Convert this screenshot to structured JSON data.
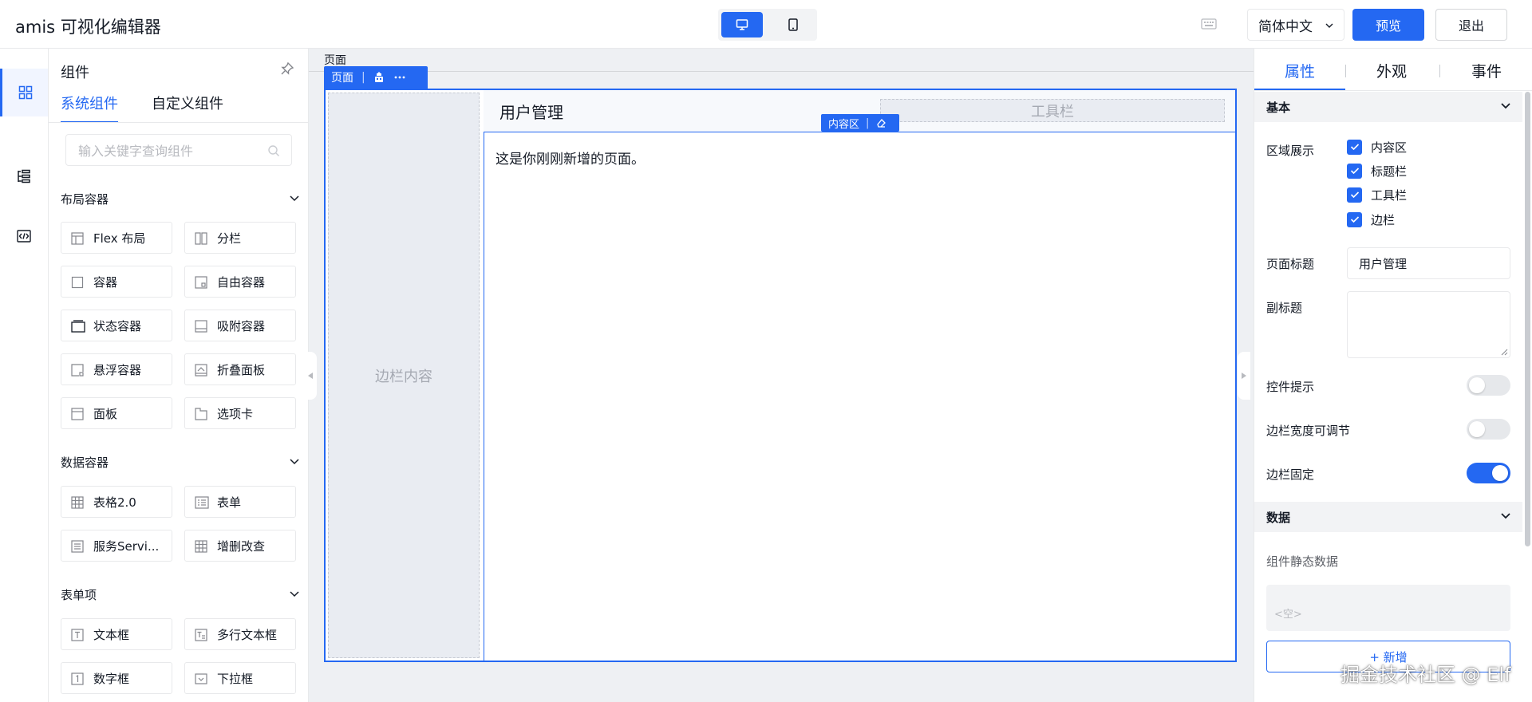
{
  "header": {
    "title": "amis 可视化编辑器",
    "language": "简体中文",
    "preview_label": "预览",
    "exit_label": "退出"
  },
  "component_panel": {
    "title": "组件",
    "tabs": [
      {
        "label": "系统组件",
        "active": true
      },
      {
        "label": "自定义组件",
        "active": false
      }
    ],
    "search_placeholder": "输入关键字查询组件",
    "groups": [
      {
        "title": "布局容器",
        "items": [
          {
            "label": "Flex 布局",
            "icon": "flex-layout-icon"
          },
          {
            "label": "分栏",
            "icon": "columns-icon"
          },
          {
            "label": "容器",
            "icon": "container-icon"
          },
          {
            "label": "自由容器",
            "icon": "free-container-icon"
          },
          {
            "label": "状态容器",
            "icon": "state-container-icon"
          },
          {
            "label": "吸附容器",
            "icon": "affix-container-icon"
          },
          {
            "label": "悬浮容器",
            "icon": "float-container-icon"
          },
          {
            "label": "折叠面板",
            "icon": "collapse-panel-icon"
          },
          {
            "label": "面板",
            "icon": "panel-icon"
          },
          {
            "label": "选项卡",
            "icon": "tabs-icon"
          }
        ]
      },
      {
        "title": "数据容器",
        "items": [
          {
            "label": "表格2.0",
            "icon": "table-icon"
          },
          {
            "label": "表单",
            "icon": "form-icon"
          },
          {
            "label": "服务Servi...",
            "icon": "service-icon"
          },
          {
            "label": "增删改查",
            "icon": "crud-icon"
          }
        ]
      },
      {
        "title": "表单项",
        "items": [
          {
            "label": "文本框",
            "icon": "text-input-icon"
          },
          {
            "label": "多行文本框",
            "icon": "textarea-icon"
          },
          {
            "label": "数字框",
            "icon": "number-input-icon"
          },
          {
            "label": "下拉框",
            "icon": "select-icon"
          }
        ]
      }
    ]
  },
  "canvas": {
    "breadcrumb": "页面",
    "page_toolbar_label": "页面",
    "aside_placeholder": "边栏内容",
    "page_title": "用户管理",
    "toolbar_placeholder": "工具栏",
    "content_tag_label": "内容区",
    "content_text": "这是你刚刚新增的页面。"
  },
  "properties": {
    "tabs": [
      {
        "label": "属性",
        "active": true
      },
      {
        "label": "外观",
        "active": false
      },
      {
        "label": "事件",
        "active": false
      }
    ],
    "section_basic": "基本",
    "region_label": "区域展示",
    "regions": [
      {
        "label": "内容区",
        "checked": true
      },
      {
        "label": "标题栏",
        "checked": true
      },
      {
        "label": "工具栏",
        "checked": true
      },
      {
        "label": "边栏",
        "checked": true
      }
    ],
    "page_title_label": "页面标题",
    "page_title_value": "用户管理",
    "subtitle_label": "副标题",
    "subtitle_value": "",
    "tooltip_label": "控件提示",
    "tooltip_on": false,
    "aside_resize_label": "边栏宽度可调节",
    "aside_resize_on": false,
    "aside_fixed_label": "边栏固定",
    "aside_fixed_on": true,
    "section_data": "数据",
    "static_data_label": "组件静态数据",
    "static_data_placeholder": "<空>",
    "add_label": "+ 新增"
  },
  "watermark": "掘金技术社区 @ Elf",
  "colors": {
    "accent": "#2468f2",
    "border": "#e8e9eb",
    "canvas_bg": "#eef0f3"
  }
}
